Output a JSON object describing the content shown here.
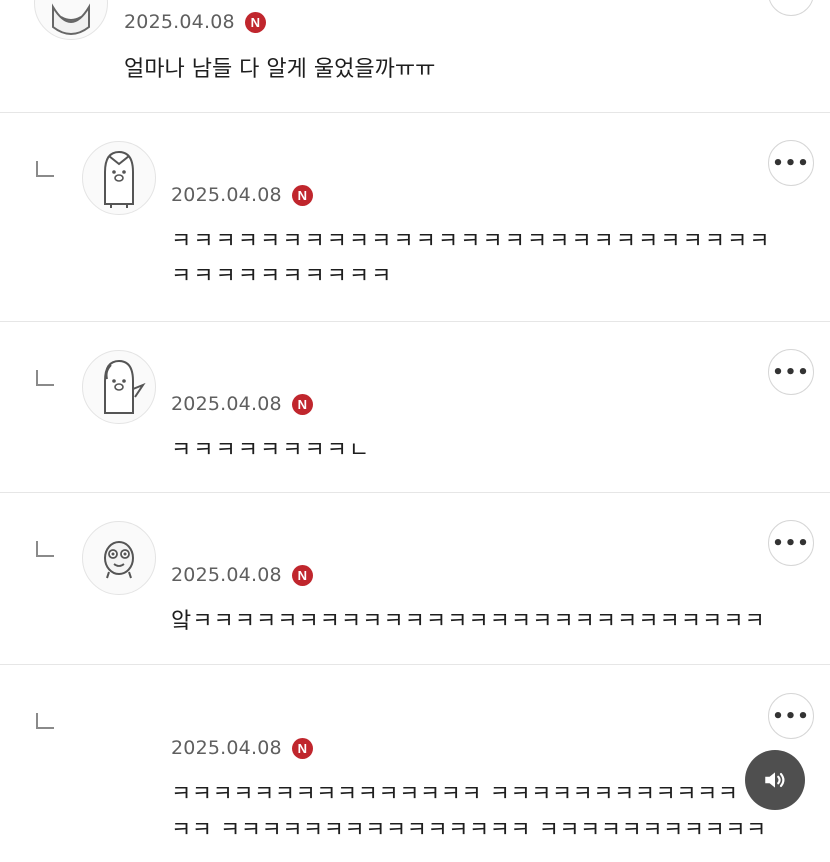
{
  "comments": [
    {
      "date": "2025.04.08",
      "badge": "N",
      "text": "얼마나 남들 다 알게 울었을까ㅠㅠ"
    },
    {
      "date": "2025.04.08",
      "badge": "N",
      "text_line1": "ㅋㅋㅋㅋㅋㅋㅋㅋㅋㅋㅋㅋㅋㅋㅋㅋㅋㅋㅋㅋㅋㅋㅋㅋㅋㅋㅋ",
      "text_line2": "ㅋㅋㅋㅋㅋㅋㅋㅋㅋㅋ",
      "more": "•••"
    },
    {
      "date": "2025.04.08",
      "badge": "N",
      "text": "ㅋㅋㅋㅋㅋㅋㅋㅋㄴ",
      "more": "•••"
    },
    {
      "date": "2025.04.08",
      "badge": "N",
      "text": "앜ㅋㅋㅋㅋㅋㅋㅋㅋㅋㅋㅋㅋㅋㅋㅋㅋㅋㅋㅋㅋㅋㅋㅋㅋㅋㅋㅋ",
      "more": "•••"
    },
    {
      "date": "2025.04.08",
      "badge": "N",
      "text_line1": "ㅋㅋㅋㅋㅋㅋㅋㅋㅋㅋㅋㅋㅋㅋㅋ ㅋㅋㅋㅋㅋㅋㅋㅋㅋㅋㅋㅋ",
      "text_line2": "ㅋㅋ ㅋㅋㅋㅋㅋㅋㅋㅋㅋㅋㅋㅋㅋㅋㅋ ㅋㅋㅋㅋㅋㅋㅋㅋㅋㅋㅋ",
      "more": "•••"
    }
  ],
  "icons": {
    "badge": "naver-n-icon",
    "more": "more-dots-icon",
    "reply": "reply-arrow-icon",
    "audio": "speaker-icon",
    "avatar": "profile-avatar-icon"
  },
  "colors": {
    "badge": "#c0262d",
    "date": "#5f5f5f",
    "divider": "#e6e6e6",
    "audio_button": "#2b2b2b"
  }
}
